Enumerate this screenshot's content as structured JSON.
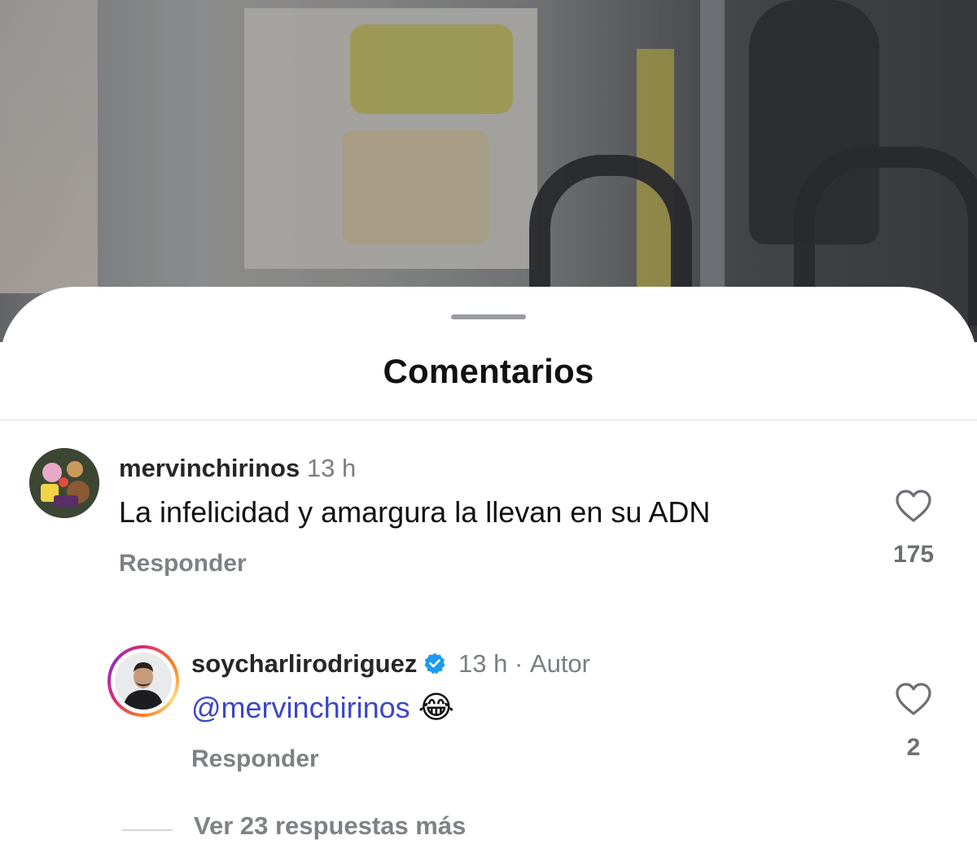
{
  "sheet": {
    "title": "Comentarios"
  },
  "comments": [
    {
      "username": "mervinchirinos",
      "time": "13 h",
      "text": "La infelicidad y amargura la llevan en su ADN",
      "reply_label": "Responder",
      "likes": "175"
    },
    {
      "username": "soycharlirodriguez",
      "verified": true,
      "time": "13 h",
      "separator": "·",
      "role": "Autor",
      "mention": "@mervinchirinos",
      "emoji": "😂",
      "reply_label": "Responder",
      "likes": "2"
    }
  ],
  "more_replies": "Ver 23 respuestas más",
  "colors": {
    "mention": "#3c46c8",
    "verified": "#1d9bf0",
    "meta_gray": "#7a7d82"
  },
  "icons": [
    "heart-icon",
    "verified-badge-icon"
  ]
}
